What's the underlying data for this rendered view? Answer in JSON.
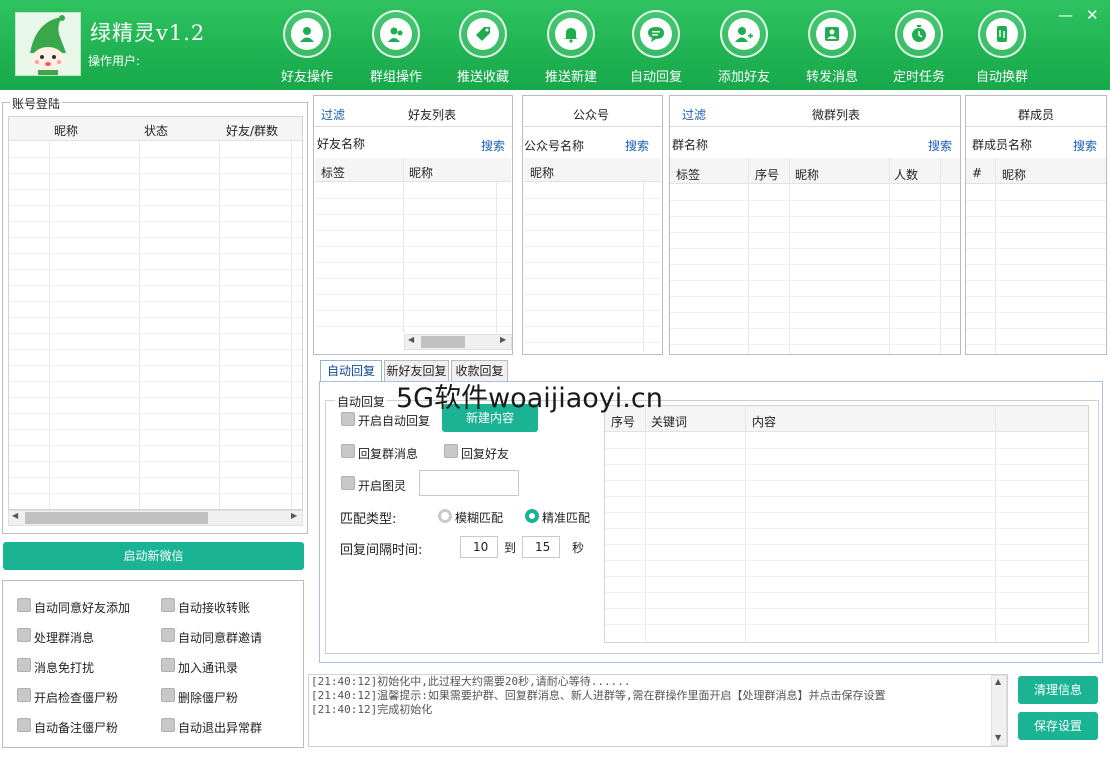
{
  "header": {
    "title": "绿精灵v1.2",
    "user_label": "操作用户:",
    "nav": [
      {
        "label": "好友操作",
        "icon": "user-icon"
      },
      {
        "label": "群组操作",
        "icon": "group-icon"
      },
      {
        "label": "推送收藏",
        "icon": "tag-icon"
      },
      {
        "label": "推送新建",
        "icon": "bell-icon"
      },
      {
        "label": "自动回复",
        "icon": "chat-icon"
      },
      {
        "label": "添加好友",
        "icon": "add-user-icon"
      },
      {
        "label": "转发消息",
        "icon": "contact-card-icon"
      },
      {
        "label": "定时任务",
        "icon": "timer-icon"
      },
      {
        "label": "自动换群",
        "icon": "phone-swap-icon"
      }
    ],
    "minimize": "—",
    "close": "✕"
  },
  "accounts": {
    "legend": "账号登陆",
    "columns": [
      "昵称",
      "状态",
      "好友/群数"
    ],
    "start_button": "启动新微信"
  },
  "options": [
    {
      "left": "自动同意好友添加",
      "right": "自动接收转账"
    },
    {
      "left": "处理群消息",
      "right": "自动同意群邀请"
    },
    {
      "left": "消息免打扰",
      "right": "加入通讯录"
    },
    {
      "left": "开启检查僵尸粉",
      "right": "删除僵尸粉"
    },
    {
      "left": "自动备注僵尸粉",
      "right": "自动退出异常群"
    }
  ],
  "friends": {
    "filter": "过滤",
    "title": "好友列表",
    "search_label": "好友名称",
    "search": "搜索",
    "col_tag": "标签",
    "col_nick": "昵称"
  },
  "official": {
    "title": "公众号",
    "search_label": "公众号名称",
    "search": "搜索",
    "col_nick": "昵称"
  },
  "groups": {
    "filter": "过滤",
    "title": "微群列表",
    "search_label": "群名称",
    "search": "搜索",
    "columns": [
      "标签",
      "序号",
      "昵称",
      "人数"
    ]
  },
  "members": {
    "title": "群成员",
    "search_label": "群成员名称",
    "search": "搜索",
    "columns": [
      "#",
      "昵称"
    ]
  },
  "tabs": [
    "自动回复",
    "新好友回复",
    "收款回复"
  ],
  "auto_reply": {
    "legend": "自动回复",
    "enable": "开启自动回复",
    "new_content": "新建内容",
    "reply_group": "回复群消息",
    "reply_friend": "回复好友",
    "enable_turing": "开启图灵",
    "match_type": "匹配类型:",
    "fuzzy": "模糊匹配",
    "exact": "精准匹配",
    "interval": "回复间隔时间:",
    "from": "10",
    "to_label": "到",
    "to": "15",
    "unit": "秒",
    "table_columns": [
      "序号",
      "关键词",
      "内容"
    ]
  },
  "watermark": "5G软件woaijiaoyi.cn",
  "log": [
    "[21:40:12]初始化中,此过程大约需要20秒,请耐心等待......",
    "[21:40:12]温馨提示:如果需要护群、回复群消息、新人进群等,需在群操作里面开启【处理群消息】并点击保存设置",
    "[21:40:12]完成初始化"
  ],
  "buttons": {
    "clear": "清理信息",
    "save": "保存设置"
  },
  "colors": {
    "header": "#1eae4f",
    "accent": "#1ab394"
  }
}
